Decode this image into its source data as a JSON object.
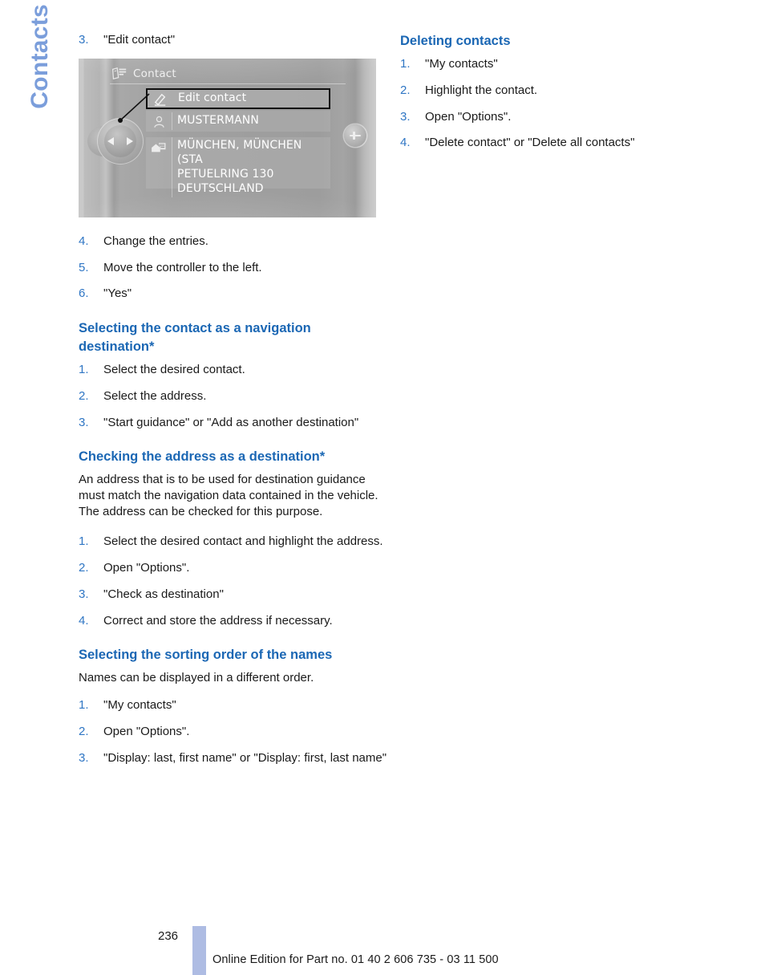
{
  "chapter": {
    "tab_label": "Contacts"
  },
  "left_column": {
    "step3": {
      "num": "3.",
      "text": "\"Edit contact\""
    },
    "figure": {
      "header_title": "Contact",
      "header_icon": "contact-card-icon",
      "rows": [
        {
          "icon": "pencil-icon",
          "text": "Edit contact",
          "selected": true
        },
        {
          "icon": "person-icon",
          "text": "MUSTERMANN",
          "selected": false
        },
        {
          "icon": "map-house-icon",
          "text": "MÜNCHEN, MÜNCHEN (STA\nPETUELRING 130\nDEUTSCHLAND",
          "selected": false
        }
      ],
      "controls": {
        "knob_left_arrow": "left-arrow",
        "knob_right_arrow": "right-arrow",
        "plus_button": "plus-icon"
      }
    },
    "steps_after_figure": [
      {
        "num": "4.",
        "text": "Change the entries."
      },
      {
        "num": "5.",
        "text": "Move the controller to the left."
      },
      {
        "num": "6.",
        "text": "\"Yes\""
      }
    ],
    "section_nav_destination": {
      "heading": "Selecting the contact as a navigation destination*",
      "steps": [
        {
          "num": "1.",
          "text": "Select the desired contact."
        },
        {
          "num": "2.",
          "text": "Select the address."
        },
        {
          "num": "3.",
          "text": "\"Start guidance\" or \"Add as another destination\""
        }
      ]
    },
    "section_check_address": {
      "heading": "Checking the address as a destination*",
      "paragraph": "An address that is to be used for destination guidance must match the navigation data contained in the vehicle. The address can be checked for this purpose.",
      "steps": [
        {
          "num": "1.",
          "text": "Select the desired contact and highlight the address."
        },
        {
          "num": "2.",
          "text": "Open \"Options\"."
        },
        {
          "num": "3.",
          "text": "\"Check as destination\""
        },
        {
          "num": "4.",
          "text": "Correct and store the address if necessary."
        }
      ]
    },
    "section_sorting_order": {
      "heading": "Selecting the sorting order of the names",
      "paragraph": "Names can be displayed in a different order.",
      "steps": [
        {
          "num": "1.",
          "text": "\"My contacts\""
        },
        {
          "num": "2.",
          "text": "Open \"Options\"."
        },
        {
          "num": "3.",
          "text": "\"Display: last, first name\" or \"Display: first, last name\""
        }
      ]
    }
  },
  "right_column": {
    "section_deleting": {
      "heading": "Deleting contacts",
      "steps": [
        {
          "num": "1.",
          "text": "\"My contacts\""
        },
        {
          "num": "2.",
          "text": "Highlight the contact."
        },
        {
          "num": "3.",
          "text": "Open \"Options\"."
        },
        {
          "num": "4.",
          "text": "\"Delete contact\" or \"Delete all contacts\""
        }
      ]
    }
  },
  "footer": {
    "page_number": "236",
    "edition_text": "Online Edition for Part no. 01 40 2 606 735 - 03 11 500"
  },
  "colors": {
    "heading_blue": "#1b67b4",
    "list_number_blue": "#2f76c4",
    "chapter_tab_blue": "#7b9edb",
    "footer_bar_blue": "#aebce3",
    "body_text": "#1a1a1a"
  }
}
